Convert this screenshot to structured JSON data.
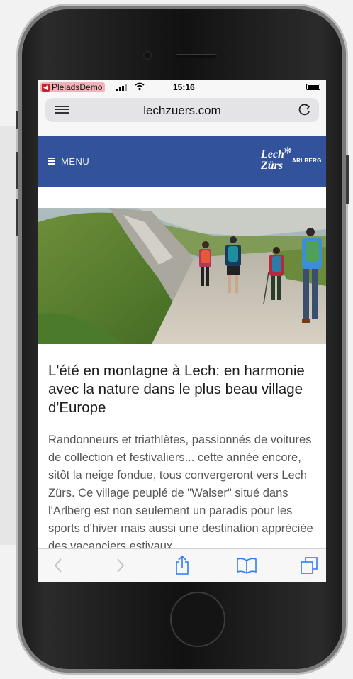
{
  "status_bar": {
    "carrier": "PleiadsDemo",
    "time": "15:16"
  },
  "browser": {
    "url": "lechzuers.com"
  },
  "site_header": {
    "menu_label": "MENU",
    "logo_line1": "Lech",
    "logo_line2": "Zürs",
    "logo_arlberg": "ARLBERG"
  },
  "article": {
    "title": "L'été en montagne à Lech: en harmonie avec la nature dans le plus beau village d'Europe",
    "body": "Randonneurs et triathlètes, passionnés de voitures de collection et festivaliers... cette année encore, sitôt la neige fondue, tous convergeront vers Lech Zürs. Ce village peuplé de \"Walser\" situé dans l'Arlberg est non seulement un paradis pour les sports d'hiver mais aussi une destination appréciée des vacanciers estivaux,"
  },
  "colors": {
    "header_blue": "#32529b",
    "carrier_pill": "#f2b3b8",
    "toolbar_tint": "#2f7cf6"
  },
  "icons": {
    "back": "chevron-left-icon",
    "forward": "chevron-right-icon",
    "share": "share-icon",
    "bookmarks": "bookmarks-icon",
    "tabs": "tabs-icon",
    "reload": "reload-icon",
    "reader": "reader-icon"
  }
}
